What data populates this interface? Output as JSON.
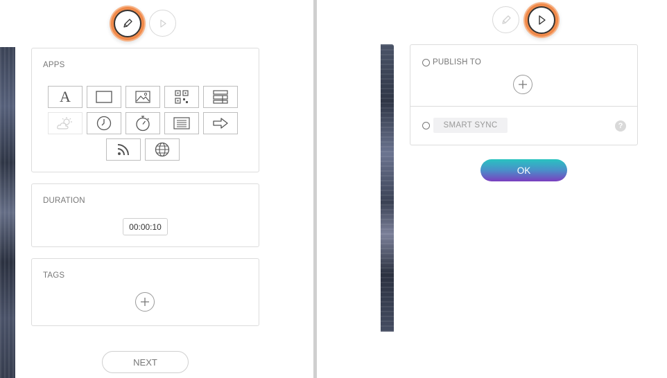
{
  "left_panel": {
    "apps_label": "APPS",
    "apps": [
      {
        "name": "text",
        "icon": "text-app-icon"
      },
      {
        "name": "rectangle",
        "icon": "rectangle-app-icon"
      },
      {
        "name": "image",
        "icon": "image-app-icon"
      },
      {
        "name": "qr-code",
        "icon": "qr-code-app-icon"
      },
      {
        "name": "table",
        "icon": "table-app-icon"
      },
      {
        "name": "weather",
        "icon": "weather-app-icon",
        "disabled": true
      },
      {
        "name": "clock",
        "icon": "clock-app-icon"
      },
      {
        "name": "timer",
        "icon": "timer-app-icon"
      },
      {
        "name": "list",
        "icon": "list-app-icon"
      },
      {
        "name": "arrow",
        "icon": "arrow-app-icon"
      },
      {
        "name": "rss",
        "icon": "rss-app-icon"
      },
      {
        "name": "web",
        "icon": "globe-app-icon"
      }
    ],
    "duration_label": "DURATION",
    "duration_value": "00:00:10",
    "tags_label": "TAGS",
    "next_label": "NEXT"
  },
  "right_panel": {
    "publish_label": "PUBLISH TO",
    "smart_sync_label": "SMART SYNC",
    "help_symbol": "?",
    "ok_label": "OK"
  },
  "colors": {
    "highlight_ring": "#f08a4b",
    "ok_gradient_top": "#29c3c0",
    "ok_gradient_bottom": "#7b3fbf"
  }
}
